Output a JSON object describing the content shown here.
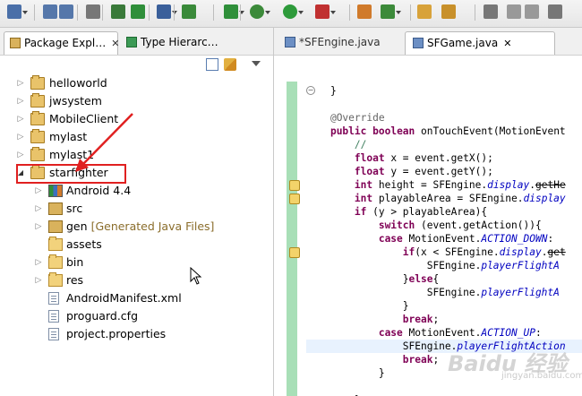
{
  "toolbar": {
    "icons": [
      "new-icon",
      "save-icon",
      "save-all-icon",
      "print-icon",
      "import-icon",
      "android-sdk-icon",
      "skip-breakpoints-icon",
      "task-icon",
      "new-android-project-icon",
      "debug-icon",
      "run-icon",
      "run-config-icon",
      "new-package-icon",
      "new-class-icon",
      "open-type-icon",
      "search-icon",
      "annotation-icon",
      "back-icon",
      "forward-icon",
      "maximize-icon"
    ]
  },
  "left_panel": {
    "tabs": [
      {
        "label": "Package Expl…",
        "icon": "package-explorer-icon",
        "close": "✕"
      },
      {
        "label": "Type Hierarc…",
        "icon": "type-hierarchy-icon",
        "close": ""
      }
    ],
    "tools": [
      "collapse-all-icon",
      "link-with-editor-icon",
      "view-menu-icon"
    ]
  },
  "tree": {
    "projects": [
      {
        "label": "helloworld",
        "expanded": false
      },
      {
        "label": "jwsystem",
        "expanded": false
      },
      {
        "label": "MobileClient",
        "expanded": false
      },
      {
        "label": "mylast",
        "expanded": false
      },
      {
        "label": "mylast1",
        "expanded": false
      },
      {
        "label": "starfighter",
        "expanded": true
      }
    ],
    "children": [
      {
        "label": "Android 4.4",
        "icon": "android-library-icon",
        "arrow": "▷"
      },
      {
        "label": "src",
        "icon": "source-folder-icon",
        "arrow": "▷"
      },
      {
        "label": "gen",
        "decoration": "[Generated Java Files]",
        "icon": "generated-folder-icon",
        "arrow": "▷"
      },
      {
        "label": "assets",
        "icon": "folder-icon",
        "arrow": ""
      },
      {
        "label": "bin",
        "icon": "folder-icon",
        "arrow": "▷"
      },
      {
        "label": "res",
        "icon": "folder-icon",
        "arrow": "▷"
      },
      {
        "label": "AndroidManifest.xml",
        "icon": "file-icon",
        "arrow": ""
      },
      {
        "label": "proguard.cfg",
        "icon": "file-icon",
        "arrow": ""
      },
      {
        "label": "project.properties",
        "icon": "file-icon",
        "arrow": ""
      }
    ]
  },
  "editor": {
    "tabs": [
      {
        "label": "*SFEngine.java",
        "active": false
      },
      {
        "label": "SFGame.java",
        "active": true,
        "close": "✕"
      }
    ],
    "code_lines": [
      "    }",
      "",
      "    @Override",
      "    public boolean onTouchEvent(MotionEvent",
      "        //",
      "        float x = event.getX();",
      "        float y = event.getY();",
      "        int height = SFEngine.display.getHe",
      "        int playableArea = SFEngine.display",
      "        if (y > playableArea){",
      "            switch (event.getAction()){",
      "            case MotionEvent.ACTION_DOWN:",
      "                if(x < SFEngine.display.get",
      "                    SFEngine.playerFlightA",
      "                }else{",
      "                    SFEngine.playerFlightA",
      "                }",
      "                break;",
      "            case MotionEvent.ACTION_UP:",
      "                SFEngine.playerFlightAction",
      "                break;",
      "            }",
      "",
      "        }"
    ]
  },
  "watermark": {
    "text": "Baidu 经验",
    "sub": "jingyan.baidu.com"
  },
  "colors": {
    "highlight": "#e02020",
    "gutter": "#a8dfb7",
    "keyword": "#7f0055",
    "static_field": "#0000c0",
    "comment": "#3f7f5f"
  }
}
